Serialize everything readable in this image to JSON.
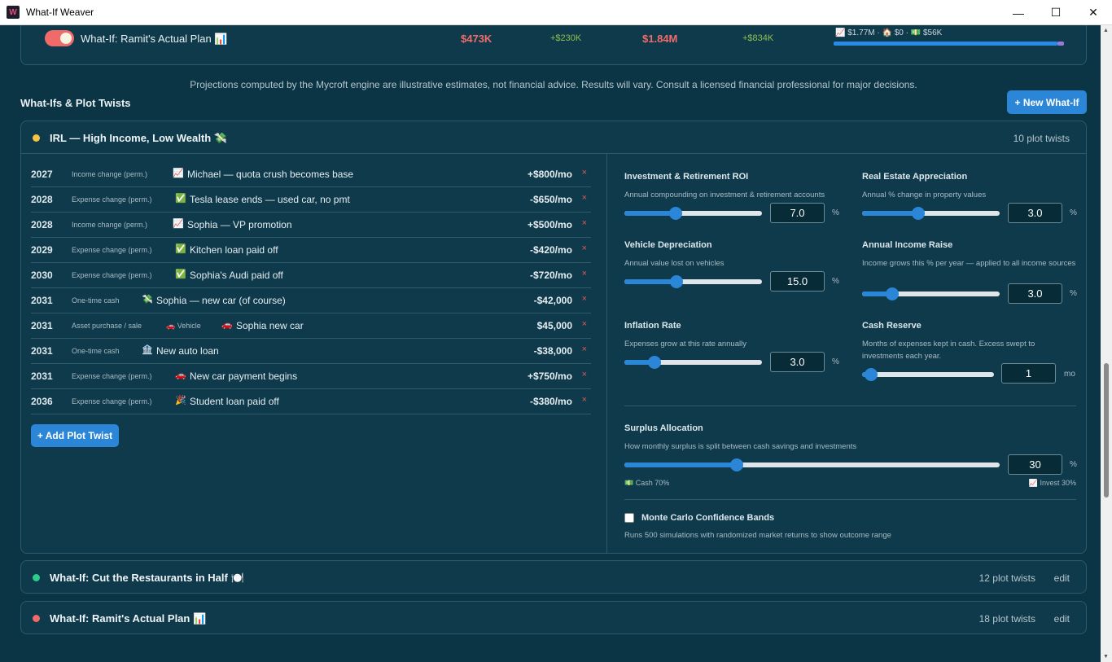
{
  "window": {
    "title": "What-If Weaver",
    "controls": [
      "—",
      "☐",
      "✕"
    ]
  },
  "active_scenario": {
    "name": "What-If: Ramit's Actual Plan 📊",
    "value_1": "$473K",
    "delta_1": "+$230K",
    "value_2": "$1.84M",
    "delta_2": "+$834K",
    "mini_summary": "📈 $1.77M · 🏠 $0 · 💵 $56K",
    "bar_fraction": 0.97
  },
  "disclaimer": "Projections computed by the Mycroft engine are illustrative estimates, not financial advice. Results will vary. Consult a licensed financial professional for major decisions.",
  "section_title": "What-Ifs & Plot Twists",
  "new_whatif_label": "+ New What-If",
  "main_whatif": {
    "title": "IRL — High Income, Low Wealth 💸",
    "count": "10 plot twists",
    "dot_color": "#f5c542",
    "twists": [
      {
        "year": "2027",
        "type": "Income change (perm.)",
        "icon": "📈",
        "label": "Michael — quota crush becomes base",
        "amount": "+$800/mo"
      },
      {
        "year": "2028",
        "type": "Expense change (perm.)",
        "icon": "✅",
        "label": "Tesla lease ends — used car, no pmt",
        "amount": "-$650/mo"
      },
      {
        "year": "2028",
        "type": "Income change (perm.)",
        "icon": "📈",
        "label": "Sophia — VP promotion",
        "amount": "+$500/mo"
      },
      {
        "year": "2029",
        "type": "Expense change (perm.)",
        "icon": "✅",
        "label": "Kitchen loan paid off",
        "amount": "-$420/mo"
      },
      {
        "year": "2030",
        "type": "Expense change (perm.)",
        "icon": "✅",
        "label": "Sophia's Audi paid off",
        "amount": "-$720/mo"
      },
      {
        "year": "2031",
        "type": "One-time cash",
        "icon": "💸",
        "label": "Sophia — new car (of course)",
        "amount": "-$42,000"
      },
      {
        "year": "2031",
        "type": "Asset purchase / sale",
        "sub": "🚗 Vehicle",
        "icon": "🚗",
        "label": "Sophia new car",
        "amount": "$45,000"
      },
      {
        "year": "2031",
        "type": "One-time cash",
        "icon": "🏦",
        "label": "New auto loan",
        "amount": "-$38,000"
      },
      {
        "year": "2031",
        "type": "Expense change (perm.)",
        "icon": "🚗",
        "label": "New car payment begins",
        "amount": "+$750/mo"
      },
      {
        "year": "2036",
        "type": "Expense change (perm.)",
        "icon": "🎉",
        "label": "Student loan paid off",
        "amount": "-$380/mo"
      }
    ],
    "delete_icon": "×",
    "add_twist_label": "+ Add Plot Twist"
  },
  "params": {
    "roi": {
      "title": "Investment & Retirement ROI",
      "desc": "Annual compounding on investment & retirement accounts",
      "value": "7.0",
      "unit": "%",
      "fraction": 0.37
    },
    "real_estate": {
      "title": "Real Estate Appreciation",
      "desc": "Annual % change in property values",
      "value": "3.0",
      "unit": "%",
      "fraction": 0.41
    },
    "vehicle": {
      "title": "Vehicle Depreciation",
      "desc": "Annual value lost on vehicles",
      "value": "15.0",
      "unit": "%",
      "fraction": 0.38
    },
    "income_raise": {
      "title": "Annual Income Raise",
      "desc": "Income grows this % per year — applied to all income sources",
      "value": "3.0",
      "unit": "%",
      "fraction": 0.22
    },
    "inflation": {
      "title": "Inflation Rate",
      "desc": "Expenses grow at this rate annually",
      "value": "3.0",
      "unit": "%",
      "fraction": 0.22
    },
    "cash_reserve": {
      "title": "Cash Reserve",
      "desc": "Months of expenses kept in cash. Excess swept to investments each year.",
      "value": "1",
      "unit": "mo",
      "fraction": 0.07
    },
    "surplus": {
      "title": "Surplus Allocation",
      "desc": "How monthly surplus is split between cash savings and investments",
      "value": "30",
      "unit": "%",
      "fraction": 0.3,
      "cash_label": "💵 Cash 70%",
      "invest_label": "📈 Invest 30%"
    },
    "monte_carlo": {
      "title": "Monte Carlo Confidence Bands",
      "desc": "Runs 500 simulations with randomized market returns to show outcome range",
      "checked": false
    }
  },
  "other_whatifs": [
    {
      "title": "What-If: Cut the Restaurants in Half 🍽️",
      "count": "12 plot twists",
      "edit": "edit",
      "dot_color": "#2ecc8f"
    },
    {
      "title": "What-If: Ramit's Actual Plan 📊",
      "count": "18 plot twists",
      "edit": "edit",
      "dot_color": "#f06a6a"
    }
  ],
  "colors": {
    "accent": "#2b86d8",
    "negative": "#f36b6b",
    "positive": "#8fbf4f",
    "background": "#0b3444"
  }
}
